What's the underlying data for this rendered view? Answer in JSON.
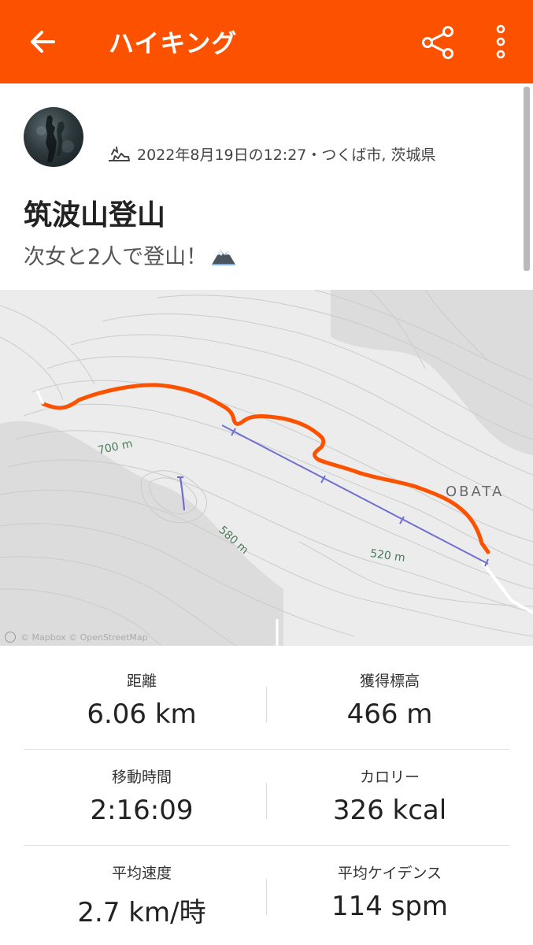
{
  "appbar": {
    "title": "ハイキング",
    "back_icon": "arrow-back-icon",
    "share_icon": "share-icon",
    "more_icon": "more-vert-icon",
    "color": "#fc5200"
  },
  "activity": {
    "type_icon": "hiking-icon",
    "meta": "2022年8月19日の12:27・つくば市, 茨城県",
    "title": "筑波山登山",
    "description": "次女と2人で登山！",
    "description_emoji_icon": "snow-capped-mountain-icon"
  },
  "map": {
    "labels": [
      "700 m",
      "580 m",
      "520 m",
      "OBATA"
    ],
    "attribution": "© Mapbox © OpenStreetMap",
    "route_color": "#fc5200"
  },
  "stats": [
    [
      {
        "label": "距離",
        "value": "6.06 km"
      },
      {
        "label": "獲得標高",
        "value": "466 m"
      }
    ],
    [
      {
        "label": "移動時間",
        "value": "2:16:09"
      },
      {
        "label": "カロリー",
        "value": "326 kcal"
      }
    ],
    [
      {
        "label": "平均速度",
        "value": "2.7 km/時"
      },
      {
        "label": "平均ケイデンス",
        "value": "114 spm"
      }
    ]
  ]
}
